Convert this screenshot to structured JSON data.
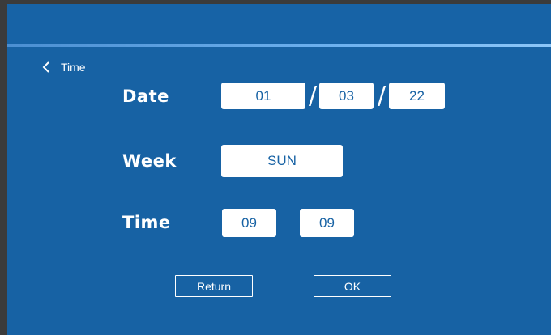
{
  "header": {
    "back_icon": "chevron-left-icon",
    "title": "Time"
  },
  "date": {
    "label": "Date",
    "day": "01",
    "month": "03",
    "year": "22",
    "separator": "/"
  },
  "week": {
    "label": "Week",
    "value": "SUN"
  },
  "time": {
    "label": "Time",
    "hour": "09",
    "minute": "09"
  },
  "buttons": {
    "return_label": "Return",
    "ok_label": "OK"
  },
  "colors": {
    "background": "#1762a4",
    "accent_line": "#6db1ef",
    "field_bg": "#ffffff",
    "field_text": "#1762a4",
    "frame": "#3b3b3b"
  }
}
